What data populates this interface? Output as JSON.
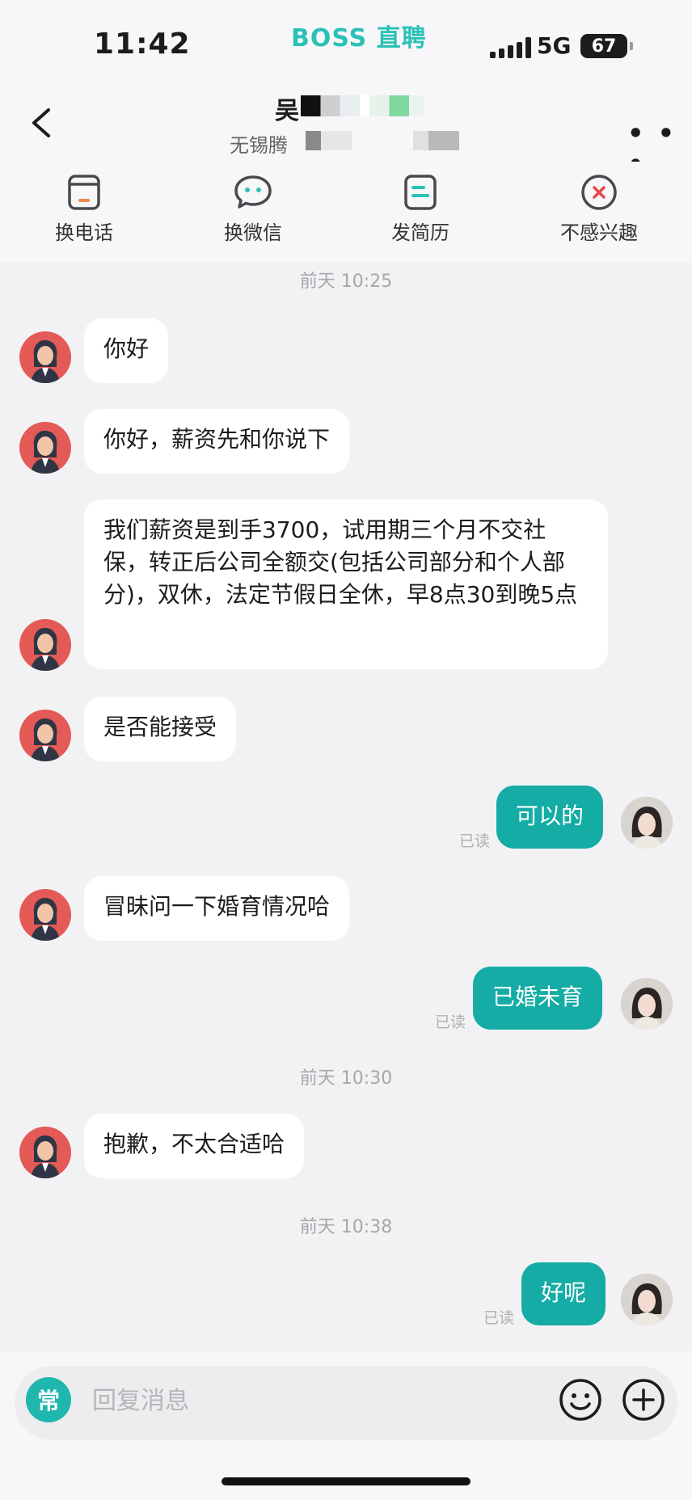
{
  "status": {
    "time": "11:42",
    "app_brand": "BOSS 直聘",
    "network": "5G",
    "battery": "67"
  },
  "header": {
    "name": "吴",
    "company": "无锡腾"
  },
  "actions": [
    {
      "label": "换电话"
    },
    {
      "label": "换微信"
    },
    {
      "label": "发简历"
    },
    {
      "label": "不感兴趣"
    }
  ],
  "chat": {
    "ts1": "前天 10:25",
    "ts2": "前天 10:30",
    "ts3": "前天 10:38",
    "m1": "你好",
    "m2": "你好，薪资先和你说下",
    "m3": "我们薪资是到手3700，试用期三个月不交社保，转正后公司全额交(包括公司部分和个人部分)，双休，法定节假日全休，早8点30到晚5点",
    "m4": "是否能接受",
    "m5": "可以的",
    "m6": "冒昧问一下婚育情况哈",
    "m7": "已婚未育",
    "m8": "抱歉，不太合适哈",
    "m9": "好呢",
    "read_label": "已读"
  },
  "composer": {
    "quick_label": "常",
    "placeholder": "回复消息"
  },
  "colors": {
    "brand": "#2cc1b7",
    "bubble_self": "#14aca5",
    "recruiter_avatar": "#e35a56"
  }
}
